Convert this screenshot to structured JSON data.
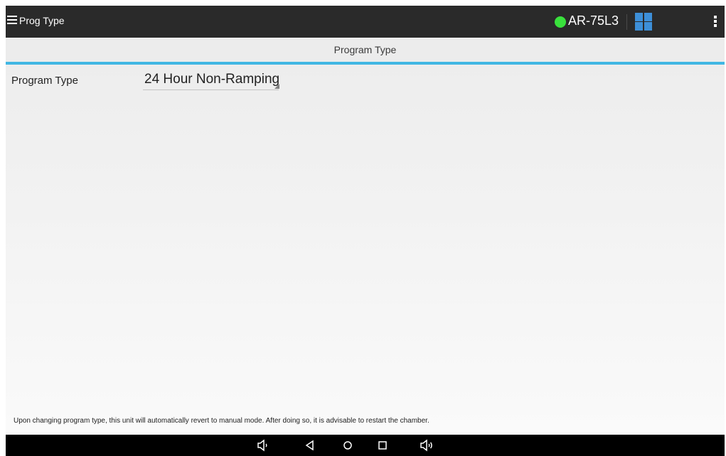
{
  "app_bar": {
    "title": "Prog Type",
    "device_name": "AR-75L3",
    "status_color": "#39e13c",
    "icons": [
      "menu-icon",
      "status-dot",
      "grid-icon",
      "overflow-menu-icon"
    ]
  },
  "subheader": {
    "title": "Program Type"
  },
  "form": {
    "program_type_label": "Program Type",
    "program_type_value": "24 Hour Non-Ramping"
  },
  "footer_note": "Upon changing program type, this unit will automatically revert to manual mode.  After doing so, it is advisable to restart the chamber.",
  "nav_bar": {
    "buttons": [
      "volume-down-icon",
      "back-icon",
      "home-icon",
      "recents-icon",
      "volume-up-icon"
    ]
  },
  "colors": {
    "app_bar_bg": "#2a2a2a",
    "accent": "#41b7e3",
    "grid_icon": "#3d8fd8",
    "nav_bar_bg": "#000000"
  }
}
